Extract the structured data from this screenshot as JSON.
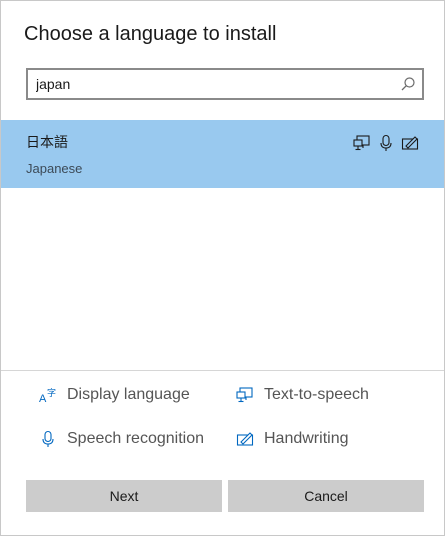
{
  "dialog": {
    "title": "Choose a language to install"
  },
  "search": {
    "value": "japan",
    "placeholder": "",
    "icon": "search-icon"
  },
  "languages": [
    {
      "native_name": "日本語",
      "english_name": "Japanese",
      "selected": true,
      "features": [
        "text-to-speech-icon",
        "speech-recognition-icon",
        "handwriting-icon"
      ]
    }
  ],
  "legend": {
    "display_language": "Display language",
    "text_to_speech": "Text-to-speech",
    "speech_recognition": "Speech recognition",
    "handwriting": "Handwriting"
  },
  "buttons": {
    "next": "Next",
    "cancel": "Cancel"
  },
  "colors": {
    "selection": "#99c9ef",
    "accent_icon": "#0067c0",
    "button_bg": "#cccccc"
  }
}
